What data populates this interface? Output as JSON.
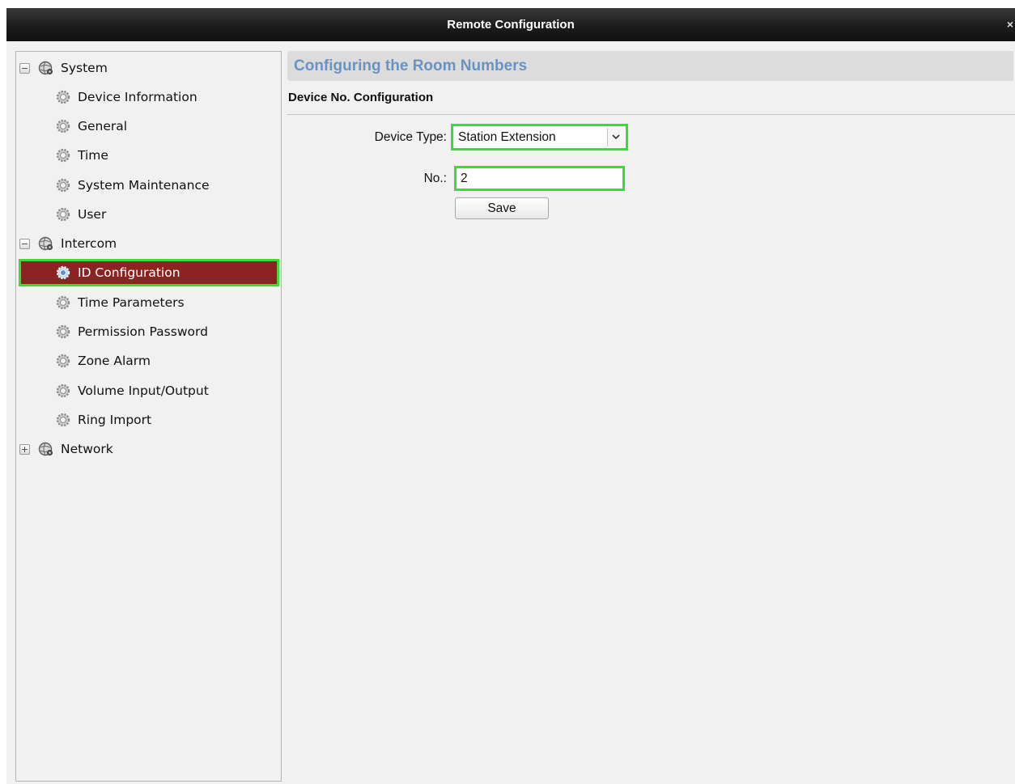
{
  "window": {
    "title": "Remote Configuration",
    "close_label": "×"
  },
  "tree": {
    "system": {
      "label": "System",
      "expander": "−",
      "children": [
        "Device Information",
        "General",
        "Time",
        "System Maintenance",
        "User"
      ]
    },
    "intercom": {
      "label": "Intercom",
      "expander": "−",
      "children": [
        "ID Configuration",
        "Time Parameters",
        "Permission Password",
        "Zone Alarm",
        "Volume Input/Output",
        "Ring Import"
      ],
      "selected": "ID Configuration"
    },
    "network": {
      "label": "Network",
      "expander": "+"
    }
  },
  "main": {
    "header_title": "Configuring the Room Numbers",
    "section_title": "Device No. Configuration",
    "device_type_label": "Device Type:",
    "device_type_value": "Station Extension",
    "number_label": "No.:",
    "number_value": "2",
    "save_label": "Save"
  },
  "colors": {
    "selected_bg": "#8b2323",
    "highlight_border": "#33e033",
    "header_title": "#6b93c0"
  },
  "icons": {
    "group_icon": "globe-gear-icon",
    "leaf_icon": "gear-icon",
    "dropdown_icon": "chevron-down-icon"
  }
}
